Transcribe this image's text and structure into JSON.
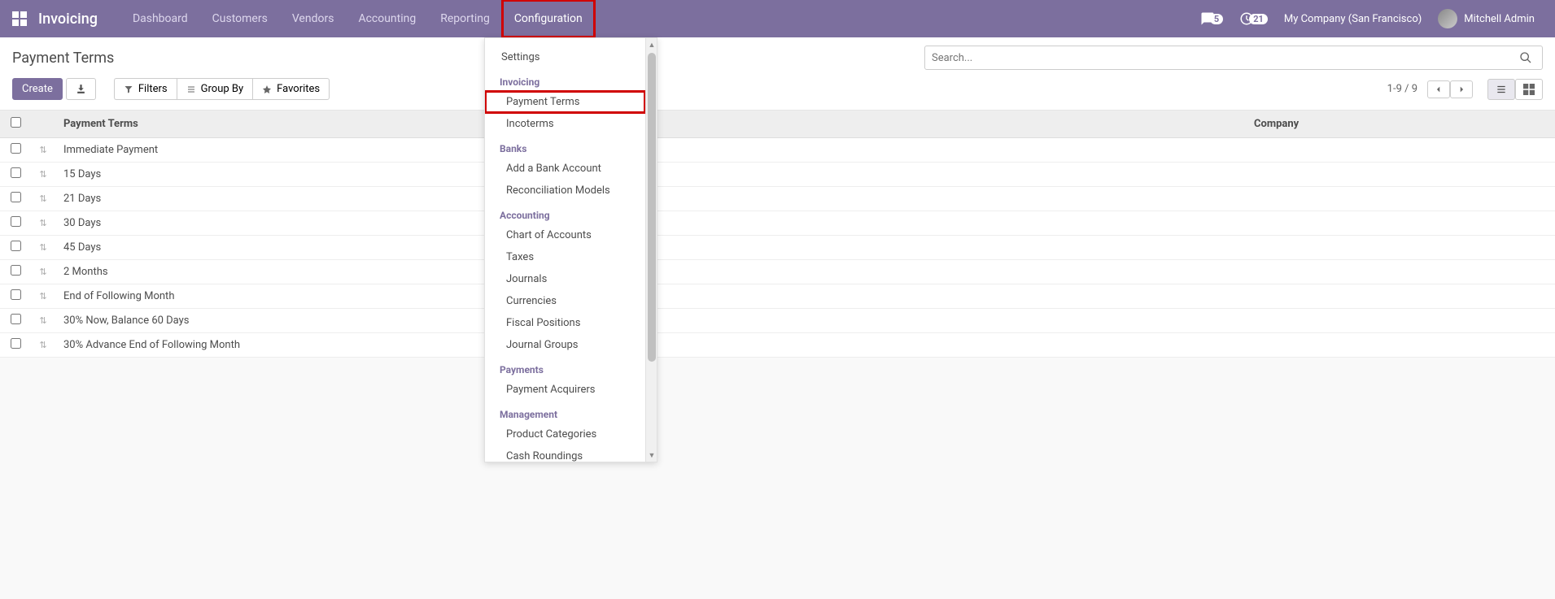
{
  "navbar": {
    "app_title": "Invoicing",
    "links": [
      "Dashboard",
      "Customers",
      "Vendors",
      "Accounting",
      "Reporting",
      "Configuration"
    ],
    "active_link_index": 5,
    "messages_badge": "5",
    "activities_badge": "21",
    "company_label": "My Company (San Francisco)",
    "user_label": "Mitchell Admin"
  },
  "page": {
    "title": "Payment Terms",
    "create_label": "Create",
    "search_placeholder": "Search..."
  },
  "filters": {
    "filters_label": "Filters",
    "groupby_label": "Group By",
    "favorites_label": "Favorites"
  },
  "pager": {
    "range": "1-9 / 9"
  },
  "table": {
    "col_terms": "Payment Terms",
    "col_company": "Company",
    "rows": [
      "Immediate Payment",
      "15 Days",
      "21 Days",
      "30 Days",
      "45 Days",
      "2 Months",
      "End of Following Month",
      "30% Now, Balance 60 Days",
      "30% Advance End of Following Month"
    ]
  },
  "dropdown": {
    "settings": "Settings",
    "sections": [
      {
        "header": "Invoicing",
        "items": [
          "Payment Terms",
          "Incoterms"
        ]
      },
      {
        "header": "Banks",
        "items": [
          "Add a Bank Account",
          "Reconciliation Models"
        ]
      },
      {
        "header": "Accounting",
        "items": [
          "Chart of Accounts",
          "Taxes",
          "Journals",
          "Currencies",
          "Fiscal Positions",
          "Journal Groups"
        ]
      },
      {
        "header": "Payments",
        "items": [
          "Payment Acquirers"
        ]
      },
      {
        "header": "Management",
        "items": [
          "Product Categories",
          "Cash Roundings"
        ]
      }
    ],
    "highlighted_item": "Payment Terms"
  }
}
